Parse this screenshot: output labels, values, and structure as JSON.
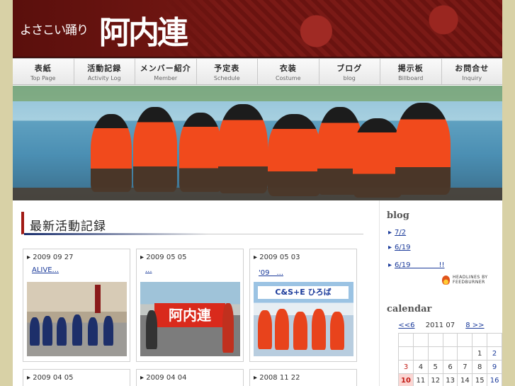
{
  "header": {
    "logo_small": "よさこい踊り",
    "logo_big": "阿内連"
  },
  "nav": [
    {
      "jp": "表紙",
      "en": "Top Page"
    },
    {
      "jp": "活動記録",
      "en": "Activity Log"
    },
    {
      "jp": "メンバー紹介",
      "en": "Member"
    },
    {
      "jp": "予定表",
      "en": "Schedule"
    },
    {
      "jp": "衣装",
      "en": "Costume"
    },
    {
      "jp": "ブログ",
      "en": "blog"
    },
    {
      "jp": "掲示板",
      "en": "Billboard"
    },
    {
      "jp": "お問合せ",
      "en": "Inquiry"
    }
  ],
  "main": {
    "section_title": "最新活動記録",
    "cards": [
      {
        "date": "2009 09 27",
        "link": "ALIVE..."
      },
      {
        "date": "2009 05 05",
        "link": "..."
      },
      {
        "date": "2009 05 03",
        "link": "'09　..."
      },
      {
        "date": "2009 04 05",
        "link": ""
      },
      {
        "date": "2009 04 04",
        "link": ""
      },
      {
        "date": "2008 11 22",
        "link": ""
      }
    ],
    "photo_sign_1": "阿内連",
    "photo_sign_2": "C&S+E ひろば"
  },
  "sidebar": {
    "blog_title": "blog",
    "blog_items": [
      "7/2",
      "6/19",
      "6/19　　　　!!"
    ],
    "feed_badge": [
      "HEADLINES BY",
      "FEEDBURNER"
    ],
    "calendar_title": "calendar",
    "calendar": {
      "prev": "<<6",
      "month": "2011 07",
      "next": "8 >>",
      "rows": [
        [
          "",
          "",
          "",
          "",
          "",
          "",
          ""
        ],
        [
          "",
          "",
          "",
          "",
          "",
          "1",
          "2"
        ],
        [
          "3",
          "4",
          "5",
          "6",
          "7",
          "8",
          "9"
        ],
        [
          "10",
          "11",
          "12",
          "13",
          "14",
          "15",
          "16"
        ]
      ],
      "today": "10"
    }
  },
  "colors": {
    "accent_red": "#a11a14",
    "link_blue": "#1a3a9a",
    "page_bg": "#d8d1a6"
  }
}
